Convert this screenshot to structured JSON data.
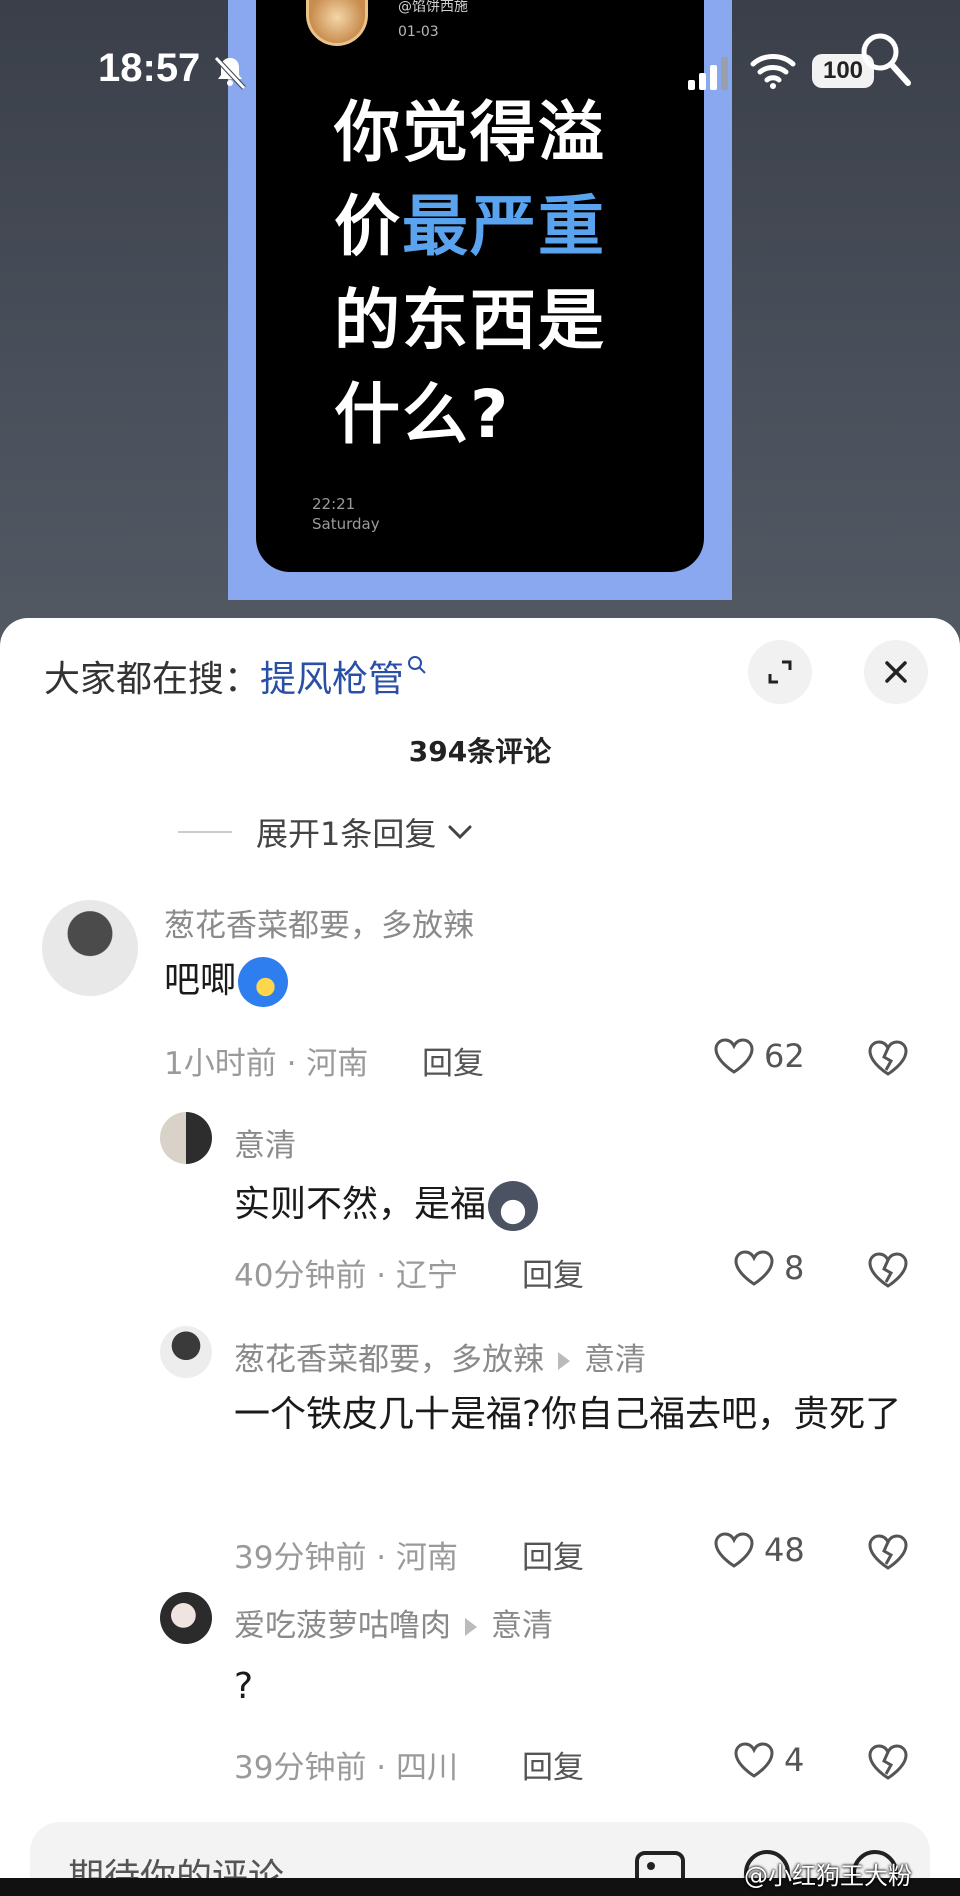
{
  "status_bar": {
    "time": "18:57",
    "battery": "100"
  },
  "poster": {
    "handle": "@馅饼西施",
    "date": "01-03",
    "title_line1": "你觉得溢",
    "title_line2_a": "价",
    "title_line2_highlight": "最严重",
    "title_line3": "的东西是",
    "title_line4": "什么?",
    "clock_time": "22:21",
    "clock_day": "Saturday"
  },
  "sheet": {
    "hot_search_prefix": "大家都在搜：",
    "hot_search_term": "提风枪管",
    "comment_count": "394条评论",
    "expand_replies": "展开1条回复"
  },
  "comments": [
    {
      "name": "葱花香菜都要，多放辣",
      "reply_to": "",
      "text": "吧唧",
      "time": "1小时前",
      "region": "河南",
      "reply_label": "回复",
      "likes": "62"
    },
    {
      "name": "意清",
      "reply_to": "",
      "text": "实则不然，是福",
      "time": "40分钟前",
      "region": "辽宁",
      "reply_label": "回复",
      "likes": "8"
    },
    {
      "name": "葱花香菜都要，多放辣",
      "reply_to": "意清",
      "text": "一个铁皮几十是福?你自己福去吧，贵死了",
      "time": "39分钟前",
      "region": "河南",
      "reply_label": "回复",
      "likes": "48"
    },
    {
      "name": "爱吃菠萝咕噜肉",
      "reply_to": "意清",
      "text": "?",
      "time": "39分钟前",
      "region": "四川",
      "reply_label": "回复",
      "likes": "4"
    }
  ],
  "input": {
    "placeholder": "期待你的评论"
  },
  "watermark": "@小红狗王大粉",
  "colors": {
    "accent_link": "#2a4fa6",
    "poster_highlight": "#5aa3ee",
    "poster_frame": "#8aa8f0"
  }
}
